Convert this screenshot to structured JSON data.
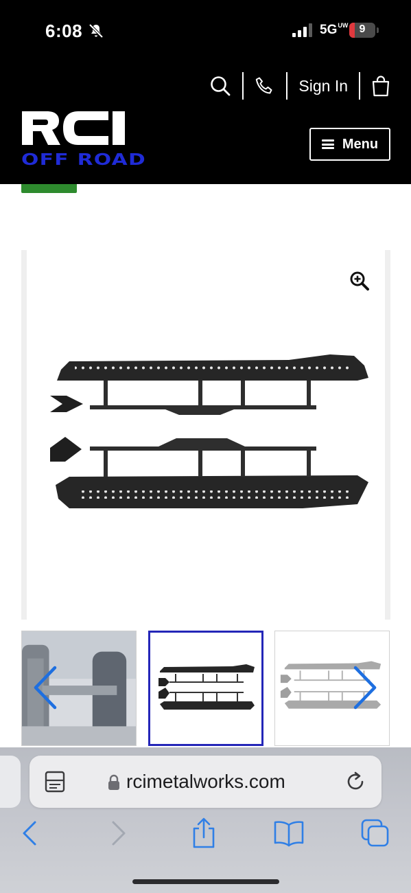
{
  "status_bar": {
    "time": "6:08",
    "network": "5G",
    "network_suffix": "UW",
    "battery_level": "9",
    "battery_fraction": 0.09,
    "icons": [
      "bell-slash-icon",
      "signal-icon",
      "battery-icon"
    ]
  },
  "header": {
    "sign_in_label": "Sign In",
    "menu_label": "Menu",
    "logo_text": "RCI OFF ROAD",
    "brand_colors": {
      "logo_white": "#ffffff",
      "logo_blue": "#1f2bd6",
      "background": "#000000"
    },
    "icons": [
      "search-icon",
      "phone-icon",
      "shopping-bag-icon",
      "hamburger-icon"
    ]
  },
  "gallery": {
    "main_image": "rock-sliders-pair",
    "selected_thumbnail": 2,
    "thumbnails": [
      "jeep-tires-photo",
      "rock-sliders-dark",
      "rock-sliders-light"
    ],
    "selected_border_color": "#2426b8",
    "arrow_color": "#1e6fe0",
    "icons": [
      "zoom-in-icon",
      "chevron-left-icon",
      "chevron-right-icon"
    ]
  },
  "browser": {
    "url": "rcimetalworks.com",
    "accent_color": "#2f7fe6",
    "icons": [
      "reader-icon",
      "lock-icon",
      "reload-icon",
      "back-icon",
      "forward-icon",
      "share-icon",
      "bookmarks-icon",
      "tabs-icon"
    ]
  }
}
